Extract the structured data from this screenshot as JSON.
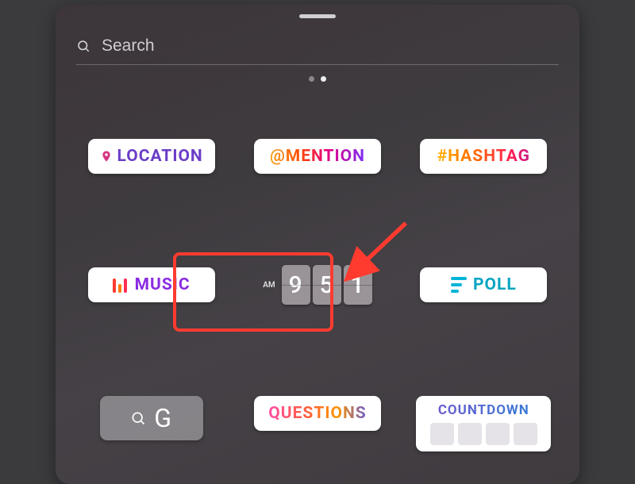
{
  "search": {
    "placeholder": "Search"
  },
  "pager": {
    "index": 1
  },
  "stickers": {
    "location": {
      "label": "LOCATION"
    },
    "mention": {
      "label": "@MENTION"
    },
    "hashtag": {
      "label": "#HASHTAG"
    },
    "music": {
      "label": "MUSIC"
    },
    "time": {
      "ampm": "AM",
      "d1": "9",
      "d2": "5",
      "d3": "1"
    },
    "poll": {
      "label": "POLL"
    },
    "gif": {
      "label": "G"
    },
    "questions": {
      "label": "QUESTIONS"
    },
    "countdown": {
      "label": "COUNTDOWN"
    }
  }
}
